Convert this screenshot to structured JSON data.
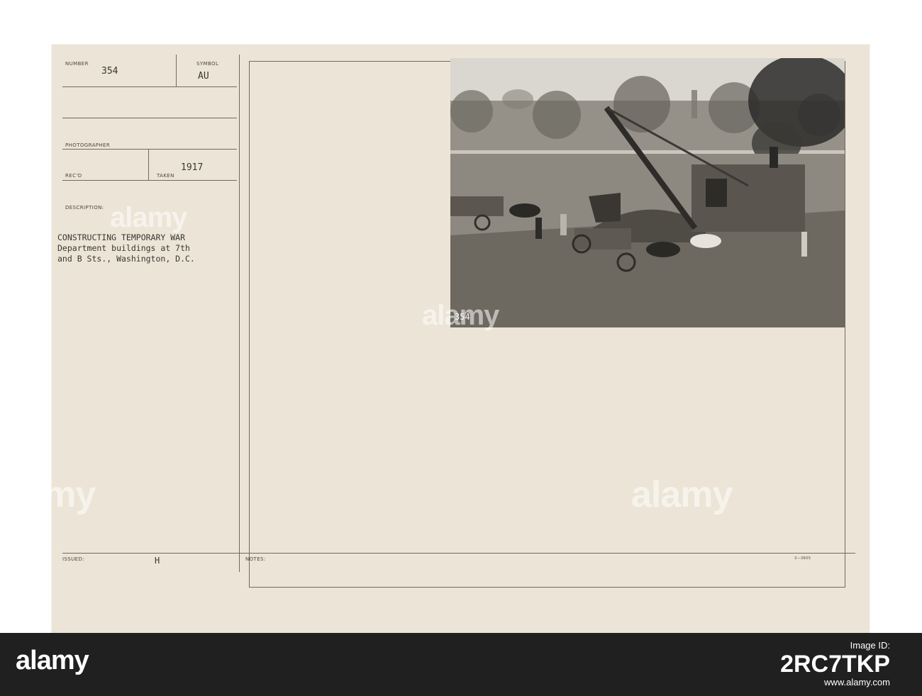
{
  "card": {
    "labels": {
      "number": "NUMBER",
      "symbol": "SYMBOL",
      "photographer": "PHOTOGRAPHER",
      "recd": "REC'D",
      "taken": "TAKEN",
      "description": "DESCRIPTION:",
      "issued": "ISSUED:",
      "notes": "NOTES:"
    },
    "number": "354",
    "symbol": "AU",
    "taken_year": "1917",
    "description": "CONSTRUCTING TEMPORARY WAR\nDepartment buildings at 7th\nand B Sts., Washington, D.C.",
    "issued_mark": "H",
    "form_number": "3—3605",
    "photo_negative_number": "354"
  },
  "watermark": {
    "text": "alamy"
  },
  "stock_bar": {
    "logo": "alamy",
    "image_id_label": "Image ID:",
    "image_id": "2RC7TKP",
    "url": "www.alamy.com"
  },
  "colors": {
    "card": "#ece4d6",
    "rule": "#6f6a63",
    "bar": "#202020"
  }
}
